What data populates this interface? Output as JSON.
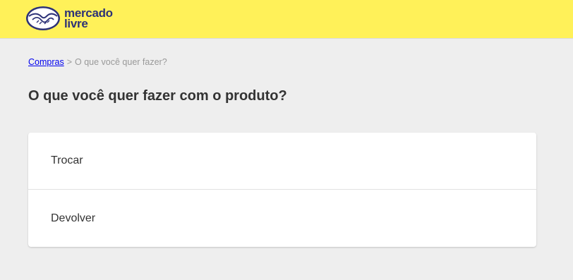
{
  "header": {
    "logo": {
      "line1": "mercado",
      "line2": "livre",
      "brand_color": "#fff159",
      "text_color": "#2d3277"
    }
  },
  "breadcrumb": {
    "link_label": "Compras",
    "separator": ">",
    "current": "O que você quer fazer?"
  },
  "page": {
    "title": "O que você quer fazer com o produto?"
  },
  "options": [
    {
      "label": "Trocar"
    },
    {
      "label": "Devolver"
    }
  ]
}
